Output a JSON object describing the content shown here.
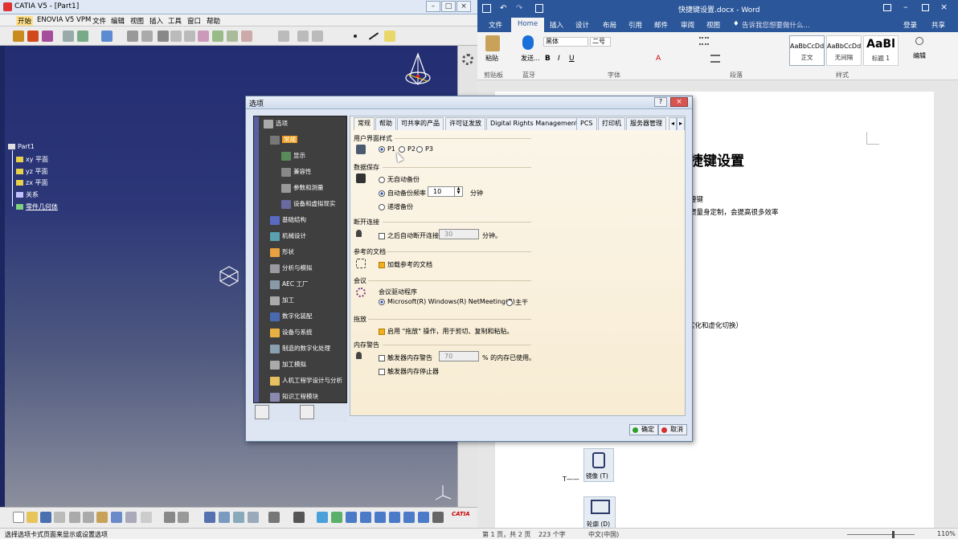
{
  "catia": {
    "title": "CATIA V5 - [Part1]",
    "menu": [
      "开始",
      "ENOVIA V5 VPM",
      "文件",
      "编辑",
      "视图",
      "插入",
      "工具",
      "窗口",
      "帮助"
    ],
    "tree": [
      "Part1",
      "xy 平面",
      "yz 平面",
      "zx 平面",
      "关系",
      "零件几何体"
    ],
    "status": "选择选项卡式页面来显示或设置选项",
    "brand": "CATIA"
  },
  "word": {
    "title": "快捷键设置.docx - Word",
    "tabs": [
      "文件",
      "Home",
      "插入",
      "设计",
      "布局",
      "引用",
      "邮件",
      "审阅",
      "视图"
    ],
    "tell_me": "告诉我您想要做什么...",
    "login": "登录",
    "share": "共享",
    "font_name": "黑体",
    "font_size": "二号",
    "groups": [
      "剪贴板",
      "蓝牙",
      "字体",
      "段落",
      "样式",
      "编辑"
    ],
    "paste": "粘贴",
    "send": "发送...",
    "styles": [
      {
        "sample": "AaBbCcDd",
        "name": "正文"
      },
      {
        "sample": "AaBbCcDd",
        "name": "无间隔"
      },
      {
        "sample": "AaBl",
        "name": "标题 1"
      }
    ],
    "doc": {
      "heading": "捷键设置",
      "line1": "捷键",
      "line2": "惯量身定制，会提高很多效率",
      "line3": "实化和虚化切换）",
      "mirror_label": "镜像 (T)",
      "contour_label": "轮廓 (D)"
    },
    "status": {
      "pages": "第 1 页，共 2 页",
      "words": "223 个字",
      "lang": "中文(中国)",
      "zoom": "110%"
    }
  },
  "dialog": {
    "title": "选项",
    "tabs": [
      "常规",
      "帮助",
      "可共享的产品",
      "许可证发放",
      "Digital Rights Management",
      "PCS",
      "打印机",
      "服务器管理"
    ],
    "tree": [
      "选项",
      "常规",
      "显示",
      "兼容性",
      "参数和测量",
      "设备和虚拟现实",
      "基础结构",
      "机械设计",
      "形状",
      "分析与模拟",
      "AEC 工厂",
      "加工",
      "数字化装配",
      "设备与系统",
      "制造的数字化处理",
      "加工模拟",
      "人机工程学设计与分析",
      "知识工程模块"
    ],
    "ui_style": {
      "title": "用户界面样式",
      "options": [
        "P1",
        "P2",
        "P3"
      ],
      "selected": "P1"
    },
    "data_save": {
      "title": "数据保存",
      "no_backup": "无自动备份",
      "auto_backup": "自动备份频率",
      "interval": "10",
      "unit": "分钟",
      "incremental": "递增备份"
    },
    "disconnect": {
      "title": "断开连接",
      "label": "之后自动断开连接",
      "value": "30",
      "unit": "分钟。"
    },
    "ref_docs": {
      "title": "参考的文档",
      "label": "加载参考的文档"
    },
    "meeting": {
      "title": "会议",
      "driver_label": "会议驱动程序",
      "option1": "Microsoft(R) Windows(R) NetMeeting(R)",
      "option2": "主干"
    },
    "drag": {
      "title": "拖放",
      "label": "启用 \"拖放\" 操作，用于剪切、复制和粘贴。"
    },
    "memory": {
      "title": "内存警告",
      "label": "触发器内存警告",
      "value": "70",
      "suffix": "% 的内存已使用。",
      "stop_label": "触发器内存停止器"
    },
    "ok": "确定",
    "cancel": "取消"
  }
}
